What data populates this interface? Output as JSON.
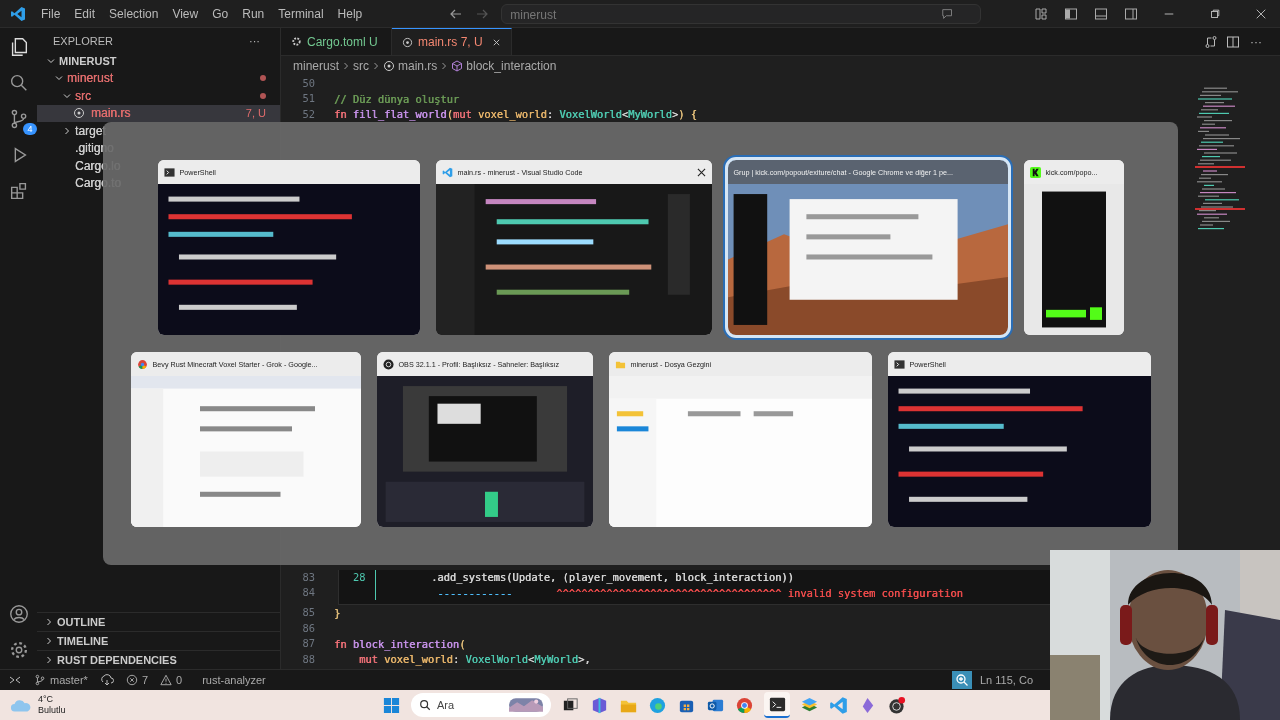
{
  "menu": [
    "File",
    "Edit",
    "Selection",
    "View",
    "Go",
    "Run",
    "Terminal",
    "Help"
  ],
  "command_center": {
    "value": "minerust"
  },
  "activity_bar": {
    "scm_badge": "4"
  },
  "sidebar": {
    "title": "EXPLORER",
    "more": "···",
    "root": "MINERUST",
    "tree": [
      {
        "name": "minerust",
        "has_errors": true,
        "expanded": true,
        "modified": true,
        "children": [
          {
            "name": "src",
            "has_errors": true,
            "expanded": true,
            "modified": true,
            "children": [
              {
                "name": "main.rs",
                "has_errors": true,
                "badge": "7, U",
                "selected": true
              }
            ]
          },
          {
            "name": "target",
            "has_errors": false,
            "expanded": false,
            "selected": false
          },
          {
            "name": ".gitigno",
            "has_errors": false,
            "selected": false
          },
          {
            "name": "Cargo.lo",
            "has_errors": false,
            "selected": false
          },
          {
            "name": "Cargo.to",
            "has_errors": false,
            "selected": false
          }
        ]
      }
    ],
    "sections": [
      "OUTLINE",
      "TIMELINE",
      "RUST DEPENDENCIES"
    ]
  },
  "tabs": [
    {
      "label": "Cargo.toml",
      "badge": "U",
      "color": "#73c991",
      "selected": false,
      "kind": "toml"
    },
    {
      "label": "main.rs",
      "badge": "7, U",
      "color": "#f48771",
      "selected": true,
      "kind": "rust"
    }
  ],
  "breadcrumb": [
    "minerust",
    "src",
    "main.rs",
    "block_interaction"
  ],
  "editor": {
    "top_lines": [
      {
        "number": "50"
      },
      {
        "number": "51",
        "tokens": [
          {
            "t": "// Düz dünya oluştur",
            "color": "#6a9955"
          }
        ]
      },
      {
        "number": "52",
        "tokens": [
          {
            "t": "fn ",
            "color": "#f07178"
          },
          {
            "t": "fill_flat_world",
            "color": "#c792ea"
          },
          {
            "t": "(",
            "color": "#e5c07b"
          },
          {
            "t": "mut ",
            "color": "#f07178"
          },
          {
            "t": "voxel_world",
            "color": "#e8b56a"
          },
          {
            "t": ": "
          },
          {
            "t": "VoxelWorld",
            "color": "#4ec9b0"
          },
          {
            "t": "<"
          },
          {
            "t": "MyWorld",
            "color": "#4ec9b0"
          },
          {
            "t": ">"
          },
          {
            "t": ") {",
            "color": "#e5c07b"
          }
        ]
      }
    ],
    "peek": [
      {
        "number": "83",
        "ref": "28",
        "tokens": [
          {
            "t": "        .add_systems(Update, (player_movement, block_interaction))"
          }
        ]
      },
      {
        "number": "84",
        "tokens": [
          {
            "t": "         ------------",
            "color": "#4fc1ff"
          },
          {
            "t": "       ^^^^^^^^^^^^^^^^^^^^^^^^^^^^^^^^^^^^ invalid system configuration",
            "color": "#f14c4c"
          }
        ]
      }
    ],
    "bottom_lines": [
      {
        "number": "85",
        "tokens": [
          {
            "t": "}",
            "color": "#e5c07b"
          }
        ]
      },
      {
        "number": "86"
      },
      {
        "number": "87",
        "tokens": [
          {
            "t": "fn ",
            "color": "#f07178"
          },
          {
            "t": "block_interaction",
            "color": "#c792ea"
          },
          {
            "t": "(",
            "color": "#e5c07b"
          }
        ]
      },
      {
        "number": "88",
        "tokens": [
          {
            "t": "    mut ",
            "color": "#f07178"
          },
          {
            "t": "voxel_world",
            "color": "#e8b56a"
          },
          {
            "t": ": "
          },
          {
            "t": "VoxelWorld",
            "color": "#4ec9b0"
          },
          {
            "t": "<"
          },
          {
            "t": "MyWorld",
            "color": "#4ec9b0"
          },
          {
            "t": ">,"
          }
        ]
      }
    ]
  },
  "switcher": {
    "rows": [
      {
        "windows": [
          {
            "title": "PowerShell",
            "selected": false,
            "hovered": false
          },
          {
            "title": "main.rs - minerust - Visual Studio Code",
            "selected": false,
            "hovered": true
          },
          {
            "title": "Grup | kick.com/popout/exiture/chat - Google Chrome ve diğer 1 pe...",
            "selected": true,
            "hovered": false
          },
          {
            "title": "kick.com/popo...",
            "selected": false,
            "hovered": false
          }
        ]
      },
      {
        "windows": [
          {
            "title": "Bevy Rust Minecraft Voxel Starter - Grok - Google...",
            "selected": false,
            "hovered": false
          },
          {
            "title": "OBS 32.1.1 - Profil: Başlıksız - Sahneler: Başlıksız",
            "selected": false,
            "hovered": false
          },
          {
            "title": "minerust - Dosya Gezgini",
            "selected": false,
            "hovered": false
          },
          {
            "title": "PowerShell",
            "selected": false,
            "hovered": false
          }
        ]
      }
    ]
  },
  "status_bar": {
    "branch": "master*",
    "errors": "7",
    "warnings": "0",
    "language_server": "rust-analyzer",
    "position": "Ln 115, Co"
  },
  "taskbar": {
    "temperature": "4°C",
    "weather": "Bulutlu",
    "search_placeholder": "Ara"
  }
}
